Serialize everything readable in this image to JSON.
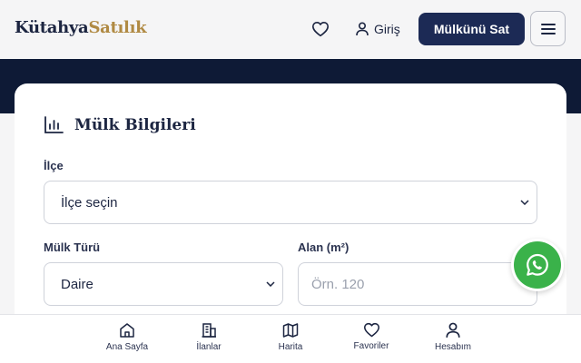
{
  "header": {
    "logo_part1": "Kütahya",
    "logo_part2": "Satılık",
    "login_label": "Giriş",
    "sell_label": "Mülkünü Sat",
    "colors": {
      "navy": "#1c2a55",
      "gold": "#b08a43"
    }
  },
  "form": {
    "section_title": "Mülk Bilgileri",
    "district": {
      "label": "İlçe",
      "value": "İlçe seçin"
    },
    "property_type": {
      "label": "Mülk Türü",
      "value": "Daire"
    },
    "area": {
      "label": "Alan (m²)",
      "placeholder": "Örn. 120"
    }
  },
  "bottom_nav": {
    "items": [
      {
        "label": "Ana Sayfa",
        "icon": "home-icon"
      },
      {
        "label": "İlanlar",
        "icon": "building-icon"
      },
      {
        "label": "Harita",
        "icon": "map-icon"
      },
      {
        "label": "Favoriler",
        "icon": "heart-icon"
      },
      {
        "label": "Hesabım",
        "icon": "user-icon"
      }
    ]
  },
  "fab": {
    "icon": "whatsapp-icon",
    "color": "#3ab24a"
  }
}
